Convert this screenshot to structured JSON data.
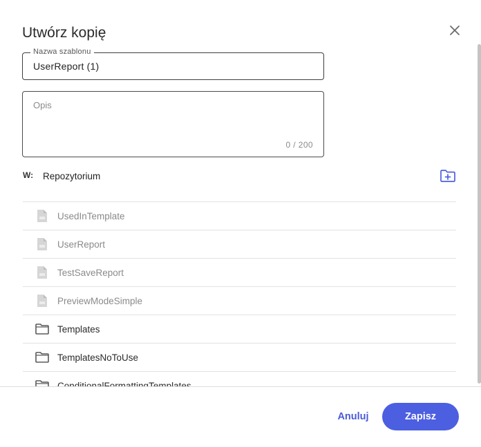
{
  "dialog": {
    "title": "Utwórz kopię",
    "close_icon": "close-icon"
  },
  "template_name": {
    "label": "Nazwa szablonu",
    "value": "UserReport (1)"
  },
  "description": {
    "placeholder": "Opis",
    "value": "",
    "counter": "0 / 200"
  },
  "location": {
    "prefix": "W:",
    "name": "Repozytorium",
    "new_folder_icon": "folder-plus-icon"
  },
  "items": [
    {
      "type": "file",
      "label": "UsedInTemplate",
      "icon": "report-file-icon"
    },
    {
      "type": "file",
      "label": "UserReport",
      "icon": "report-file-icon"
    },
    {
      "type": "file",
      "label": "TestSaveReport",
      "icon": "report-file-icon"
    },
    {
      "type": "file",
      "label": "PreviewModeSimple",
      "icon": "report-file-icon"
    },
    {
      "type": "folder",
      "label": "Templates",
      "icon": "folder-icon"
    },
    {
      "type": "folder",
      "label": "TemplatesNoToUse",
      "icon": "folder-icon"
    },
    {
      "type": "folder",
      "label": "ConditionalFormattingTemplates",
      "icon": "folder-icon"
    }
  ],
  "actions": {
    "cancel_label": "Anuluj",
    "save_label": "Zapisz"
  },
  "colors": {
    "accent": "#4c5fe0",
    "file_text": "#8a8a8a",
    "icon_gray": "#d6d6d6"
  }
}
